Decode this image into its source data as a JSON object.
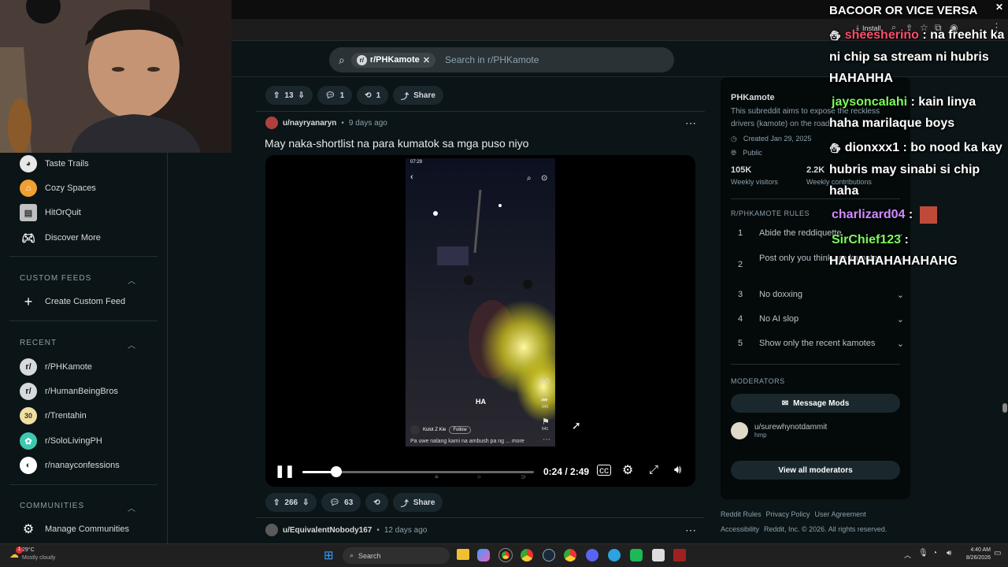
{
  "browser": {
    "install_label": "Install",
    "search_placeholder": "Search in r/PHKamote",
    "community_chip": "r/PHKamote"
  },
  "chat_overlay": {
    "title": "BACOOR OR VICE VERSA",
    "messages": [
      {
        "user": "sheesherino",
        "user_color": "#ff4d6d",
        "text": ": na freehit ka ni chip sa stream ni hubris HAHAHHA"
      },
      {
        "user": "jaysoncalahi",
        "user_color": "#7cfc5a",
        "text": ": kain linya haha marilaque boys"
      },
      {
        "user": "dionxxx1",
        "user_color": "#ffffff",
        "text": ": bo nood ka kay hubris may sinabi si chip haha"
      },
      {
        "user": "charlizard04",
        "user_color": "#d08cff",
        "text": ":"
      },
      {
        "user": "SirChief123",
        "user_color": "#7cfc5a",
        "text": ": HAHAHAHAHAHAHG"
      }
    ]
  },
  "sidebar": {
    "games": [
      {
        "label": "Taste Trails",
        "icon": "taste-trails-icon",
        "color": "#e8e8e8"
      },
      {
        "label": "Cozy Spaces",
        "icon": "cozy-spaces-icon",
        "color": "#f0a030"
      },
      {
        "label": "HitOrQuit",
        "icon": "hitorquit-icon",
        "color": "#c0c0c0"
      },
      {
        "label": "Discover More",
        "icon": "gamepad-icon",
        "color": "transparent"
      }
    ],
    "custom_feeds_header": "CUSTOM FEEDS",
    "create_custom_feed": "Create Custom Feed",
    "recent_header": "RECENT",
    "recent": [
      {
        "label": "r/PHKamote",
        "color": "#d7dadc"
      },
      {
        "label": "r/HumanBeingBros",
        "color": "#d7dadc"
      },
      {
        "label": "r/Trentahin",
        "color": "#f0e0a0"
      },
      {
        "label": "r/SoloLivingPH",
        "color": "#3ec8b0"
      },
      {
        "label": "r/nanayconfessions",
        "color": "#ffffff"
      }
    ],
    "communities_header": "COMMUNITIES",
    "manage_communities": "Manage Communities"
  },
  "feed": {
    "post1_actions": {
      "votes": "13",
      "comments": "1",
      "crossposts": "1",
      "share": "Share"
    },
    "post2": {
      "author": "u/nayryanaryn",
      "time": "9 days ago",
      "title": "May naka-shortlist na para kumatok sa mga puso niyo",
      "video": {
        "phone_time": "07:29",
        "caption_overlay": "HA",
        "tiktok_user": "Kulot Z Kie",
        "follow_label": "Follow",
        "description": "Pa uwe nalang kami na ambush pa ng ... more",
        "share_count": "945",
        "save_count": "641",
        "time_display": "0:24 / 2:49",
        "progress": 0.145
      },
      "votes": "266",
      "comments": "63",
      "share": "Share"
    },
    "post3": {
      "author": "u/EquivalentNobody167",
      "time": "12 days ago"
    }
  },
  "right_panel": {
    "name": "PHKamote",
    "description": "This subreddit aims to expose the reckless drivers (kamote) on the road.",
    "created": "Created Jan 29, 2025",
    "visibility": "Public",
    "visitors_value": "105K",
    "visitors_label": "Weekly visitors",
    "contrib_value": "2.2K",
    "contrib_label": "Weekly contributions",
    "rules_header": "R/PHKAMOTE RULES",
    "rules": [
      {
        "num": "1",
        "text": "Abide the reddiquette"
      },
      {
        "num": "2",
        "text": "Post only you think are kamotes"
      },
      {
        "num": "3",
        "text": "No doxxing"
      },
      {
        "num": "4",
        "text": "No AI slop"
      },
      {
        "num": "5",
        "text": "Show only the recent kamotes"
      }
    ],
    "moderators_header": "MODERATORS",
    "message_mods": "Message Mods",
    "moderator_name": "u/surewhynotdammit",
    "moderator_flair": "hmp",
    "view_all_mods": "View all moderators",
    "footer_links": [
      "Reddit Rules",
      "Privacy Policy",
      "User Agreement"
    ],
    "footer_links2": [
      "Accessibility",
      "Reddit, Inc. © 2026. All rights reserved."
    ]
  },
  "taskbar": {
    "weather_temp": "29°C",
    "weather_desc": "Mostly cloudy",
    "notification_badge": "1",
    "search_label": "Search",
    "clock_time": "4:40 AM",
    "clock_date": "8/26/2026"
  }
}
